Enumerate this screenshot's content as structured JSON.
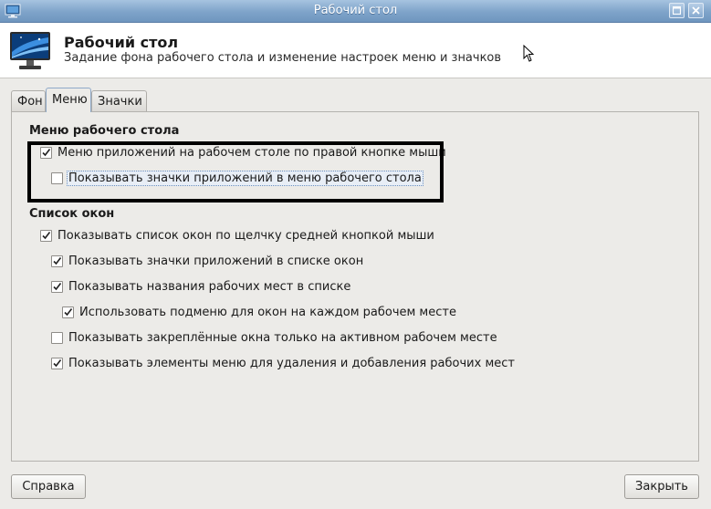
{
  "window": {
    "title": "Рабочий стол"
  },
  "header": {
    "title": "Рабочий стол",
    "subtitle": "Задание фона рабочего стола и изменение настроек меню и значков"
  },
  "tabs": [
    {
      "label": "Фон",
      "active": false
    },
    {
      "label": "Меню",
      "active": true
    },
    {
      "label": "Значки",
      "active": false
    }
  ],
  "desktop_menu": {
    "heading": "Меню рабочего стола",
    "options": [
      {
        "label": "Меню приложений на рабочем столе по правой кнопке мыши",
        "checked": true
      },
      {
        "label": "Показывать значки приложений в меню рабочего стола",
        "checked": false
      }
    ]
  },
  "window_list": {
    "heading": "Список окон",
    "options": [
      {
        "label": "Показывать список окон по щелчку средней кнопкой мыши",
        "checked": true
      },
      {
        "label": "Показывать значки приложений в списке окон",
        "checked": true
      },
      {
        "label": "Показывать названия рабочих мест в списке",
        "checked": true
      },
      {
        "label": "Использовать подменю для окон на каждом рабочем месте",
        "checked": true
      },
      {
        "label": "Показывать закреплённые окна только на активном рабочем месте",
        "checked": false
      },
      {
        "label": "Показывать элементы меню для удаления и добавления рабочих мест",
        "checked": true
      }
    ]
  },
  "buttons": {
    "help": "Справка",
    "close": "Закрыть"
  },
  "icons": {
    "app": "desktop-icon",
    "header": "monitor-icon",
    "maximize": "maximize-icon",
    "close": "close-icon"
  }
}
